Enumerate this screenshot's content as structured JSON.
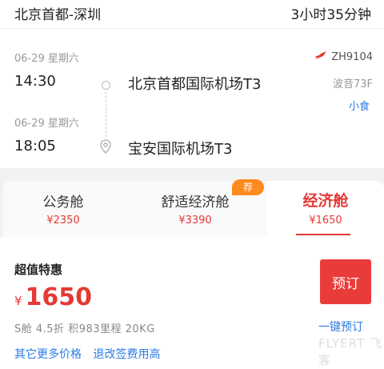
{
  "header": {
    "route": "北京首都-深圳",
    "duration": "3小时35分钟"
  },
  "flight": {
    "departure": {
      "date": "06-29 星期六",
      "time": "14:30",
      "airport": "北京首都国际机场T3"
    },
    "arrival": {
      "date": "06-29 星期六",
      "time": "18:05",
      "airport": "宝安国际机场T3"
    },
    "flight_number": "ZH9104",
    "aircraft": "波音73F",
    "meal": "小食",
    "airline_icon_color": "#e53935"
  },
  "cabins": {
    "badge": "荐",
    "items": [
      {
        "label": "公务舱",
        "price": "¥2350"
      },
      {
        "label": "舒适经济舱",
        "price": "¥3390"
      },
      {
        "label": "经济舱",
        "price": "¥1650"
      }
    ]
  },
  "offer": {
    "title": "超值特惠",
    "currency": "¥",
    "price": "1650",
    "details": "S舱  4.5折  积983里程  20KG",
    "more_prices": "其它更多价格",
    "refund_fees": "退改签费用高",
    "book_label": "预订",
    "quick_book": "一键预订",
    "watermark": "FLYERT 飞客"
  },
  "colors": {
    "accent_red": "#e53935",
    "link_blue": "#2b7be5",
    "badge_orange": "#ff8a1f"
  }
}
